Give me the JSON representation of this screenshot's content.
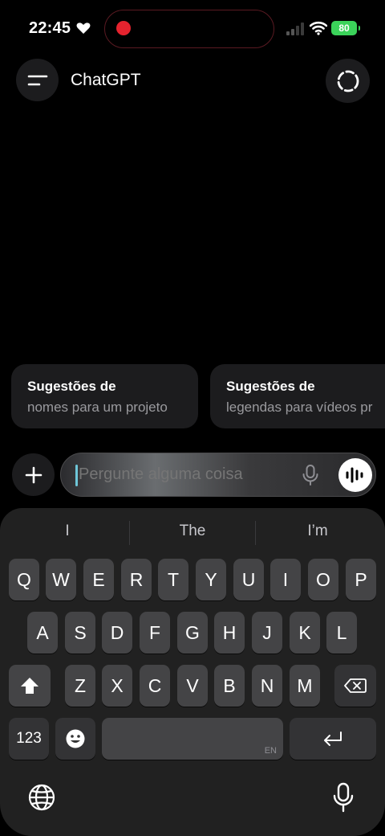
{
  "status_bar": {
    "time": "22:45",
    "battery": "80",
    "icons": [
      "heart-icon",
      "recording-dot-icon",
      "cellular-signal-icon",
      "wifi-icon",
      "battery-icon"
    ],
    "colors": {
      "recording": "#e5232e",
      "battery": "#3bd35a"
    }
  },
  "header": {
    "title": "ChatGPT",
    "icons": [
      "menu-icon",
      "temporary-chat-icon"
    ]
  },
  "suggestions": [
    {
      "title": "Sugestões de",
      "subtitle": "nomes para um projeto"
    },
    {
      "title": "Sugestões de",
      "subtitle": "legendas para vídeos pr"
    }
  ],
  "composer": {
    "placeholder": "Pergunte alguma coisa",
    "icons": [
      "plus-icon",
      "microphone-icon",
      "voice-mode-icon"
    ]
  },
  "keyboard": {
    "predictions": [
      "I",
      "The",
      "I’m"
    ],
    "row1": [
      "Q",
      "W",
      "E",
      "R",
      "T",
      "Y",
      "U",
      "I",
      "O",
      "P"
    ],
    "row2": [
      "A",
      "S",
      "D",
      "F",
      "G",
      "H",
      "J",
      "K",
      "L"
    ],
    "row3": [
      "Z",
      "X",
      "C",
      "V",
      "B",
      "N",
      "M"
    ],
    "numbers_key": "123",
    "space_lang": "EN",
    "icons": [
      "shift-icon",
      "backspace-icon",
      "emoji-icon",
      "return-icon",
      "globe-icon",
      "dictation-icon"
    ]
  }
}
